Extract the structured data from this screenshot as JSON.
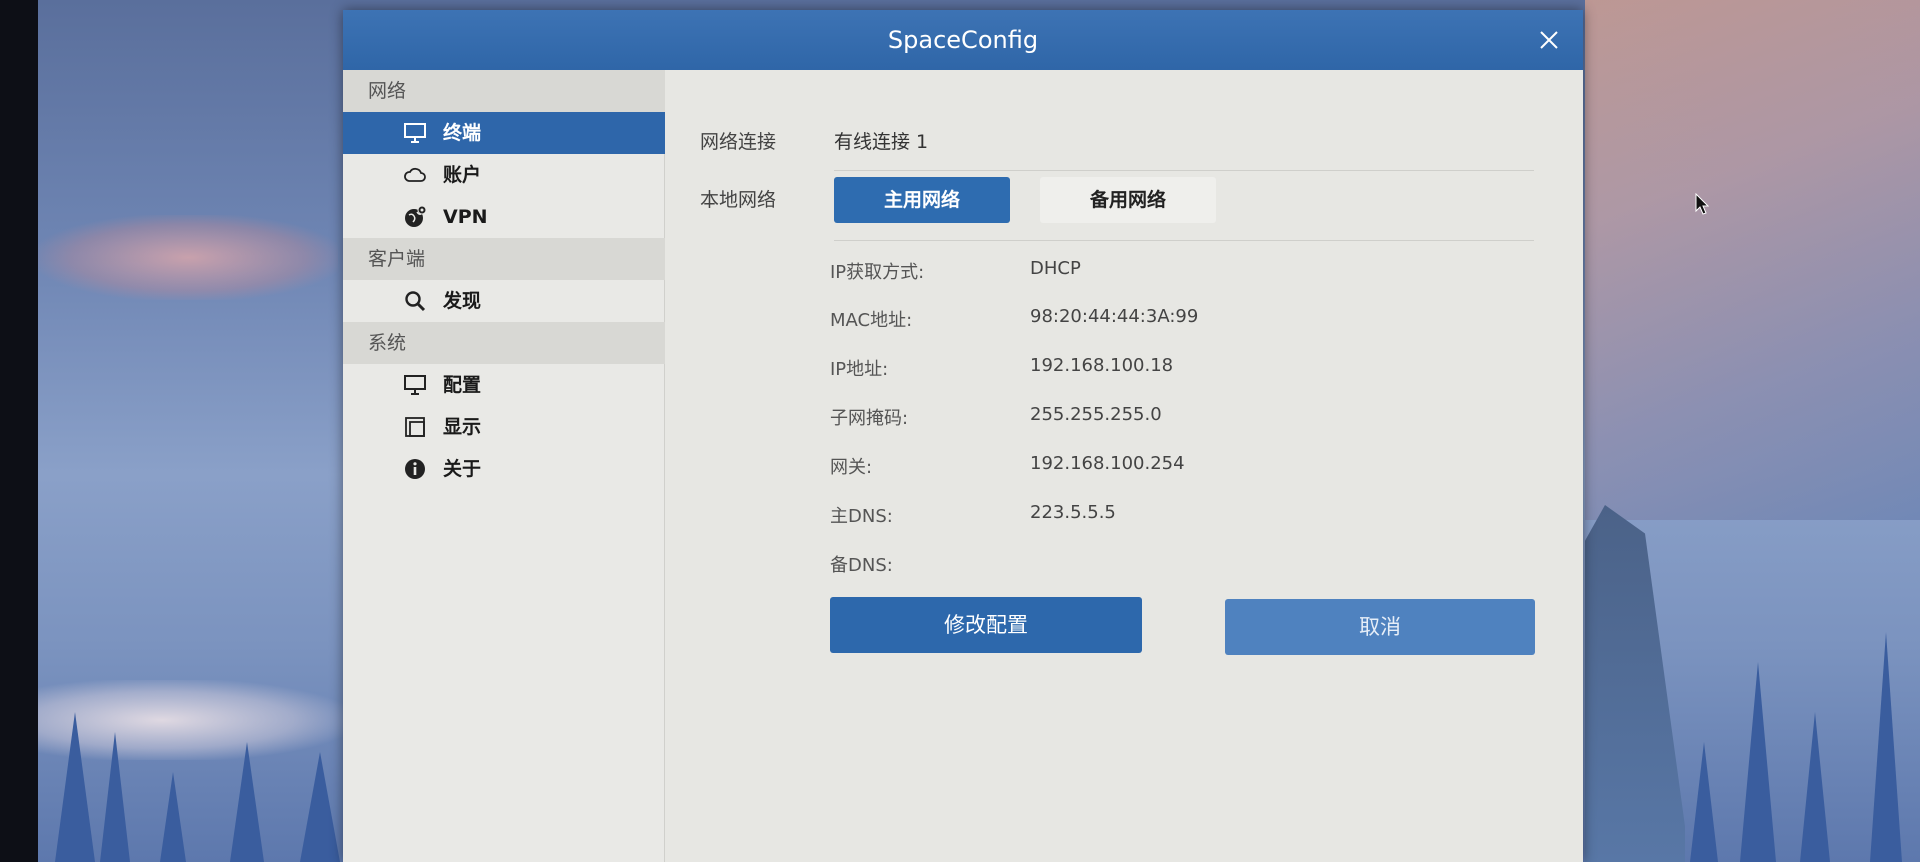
{
  "window": {
    "title": "SpaceConfig"
  },
  "sidebar": {
    "groups": [
      {
        "header": "网络",
        "items": [
          {
            "label": "终端",
            "icon": "monitor-icon",
            "active": true
          },
          {
            "label": "账户",
            "icon": "cloud-icon",
            "active": false
          },
          {
            "label": "VPN",
            "icon": "globe-gear-icon",
            "active": false
          }
        ]
      },
      {
        "header": "客户端",
        "items": [
          {
            "label": "发现",
            "icon": "search-icon",
            "active": false
          }
        ]
      },
      {
        "header": "系统",
        "items": [
          {
            "label": "配置",
            "icon": "monitor-icon",
            "active": false
          },
          {
            "label": "显示",
            "icon": "display-window-icon",
            "active": false
          },
          {
            "label": "关于",
            "icon": "info-icon",
            "active": false
          }
        ]
      }
    ]
  },
  "main": {
    "connection_label": "网络连接",
    "connection_value": "有线连接 1",
    "local_network_label": "本地网络",
    "tabs": [
      {
        "label": "主用网络",
        "active": true
      },
      {
        "label": "备用网络",
        "active": false
      }
    ],
    "fields": [
      {
        "label": "IP获取方式:",
        "value": "DHCP"
      },
      {
        "label": "MAC地址:",
        "value": "98:20:44:44:3A:99"
      },
      {
        "label": "IP地址:",
        "value": "192.168.100.18"
      },
      {
        "label": "子网掩码:",
        "value": "255.255.255.0"
      },
      {
        "label": "网关:",
        "value": "192.168.100.254"
      },
      {
        "label": "主DNS:",
        "value": "223.5.5.5"
      },
      {
        "label": "备DNS:",
        "value": ""
      }
    ],
    "modify_button": "修改配置",
    "cancel_button": "取消"
  },
  "colors": {
    "accent": "#2e66aa",
    "titlebar": "#3369ab",
    "window_bg": "#e7e7e3"
  }
}
